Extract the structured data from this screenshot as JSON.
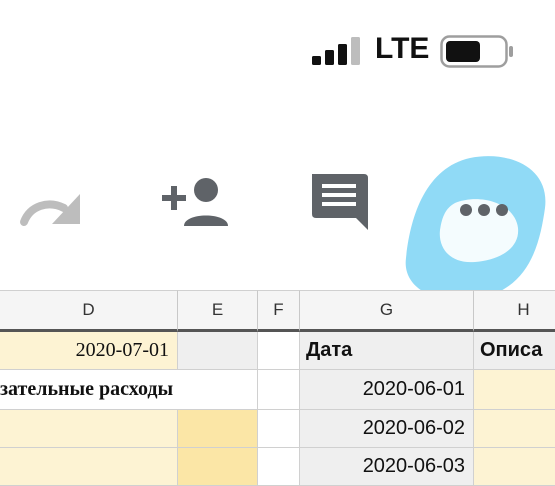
{
  "status": {
    "network": "LTE",
    "signal_bars_active": 3,
    "signal_bars_total": 4,
    "battery_level": 0.55
  },
  "toolbar": {
    "icons": [
      "redo-icon",
      "add-person-icon",
      "comment-icon",
      "more-options-icon"
    ]
  },
  "sheet": {
    "columns": [
      "D",
      "E",
      "F",
      "G",
      "H"
    ],
    "rows": [
      {
        "d": "2020-07-01",
        "g": "Дата",
        "h": "Описа"
      },
      {
        "d": "зательные расходы",
        "g": "2020-06-01"
      },
      {
        "g": "2020-06-02"
      },
      {
        "g": "2020-06-03"
      }
    ]
  },
  "colors": {
    "cell_yellow": "#fdf3d3",
    "cell_yellow_dark": "#fbe6a6",
    "highlight_scribble": "#7dd3f5",
    "icon_gray": "#5f6368"
  }
}
